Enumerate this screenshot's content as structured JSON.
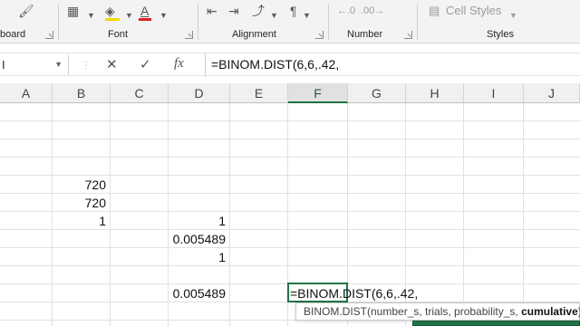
{
  "ribbon": {
    "groups": {
      "clipboard": "board",
      "font": "Font",
      "alignment": "Alignment",
      "number": "Number",
      "styles": "Styles"
    },
    "cell_styles_label": "Cell Styles",
    "font_color_letter": "A",
    "fill_color": "#f5d800",
    "font_color": "#e02020"
  },
  "formula_bar": {
    "name_box_value": "I",
    "cancel": "✕",
    "enter": "✓",
    "fx": "fx",
    "content": "=BINOM.DIST(6,6,.42,"
  },
  "columns": [
    "A",
    "B",
    "C",
    "D",
    "E",
    "F",
    "G",
    "H",
    "I",
    "J"
  ],
  "selected_column": "F",
  "cells": {
    "B_r5": "720",
    "B_r6": "720",
    "B_r7": "1",
    "D_r7": "1",
    "D_r8": "0.005489",
    "D_r9": "1",
    "D_r11": "0.005489"
  },
  "editing": {
    "text": "=BINOM.DIST(6,6,.42,"
  },
  "tooltip": {
    "func": "BINOM.DIST(",
    "args": "number_s, trials, probability_s,",
    "current_arg": "cumulative",
    "close": ")"
  },
  "accent_color": "#217346"
}
